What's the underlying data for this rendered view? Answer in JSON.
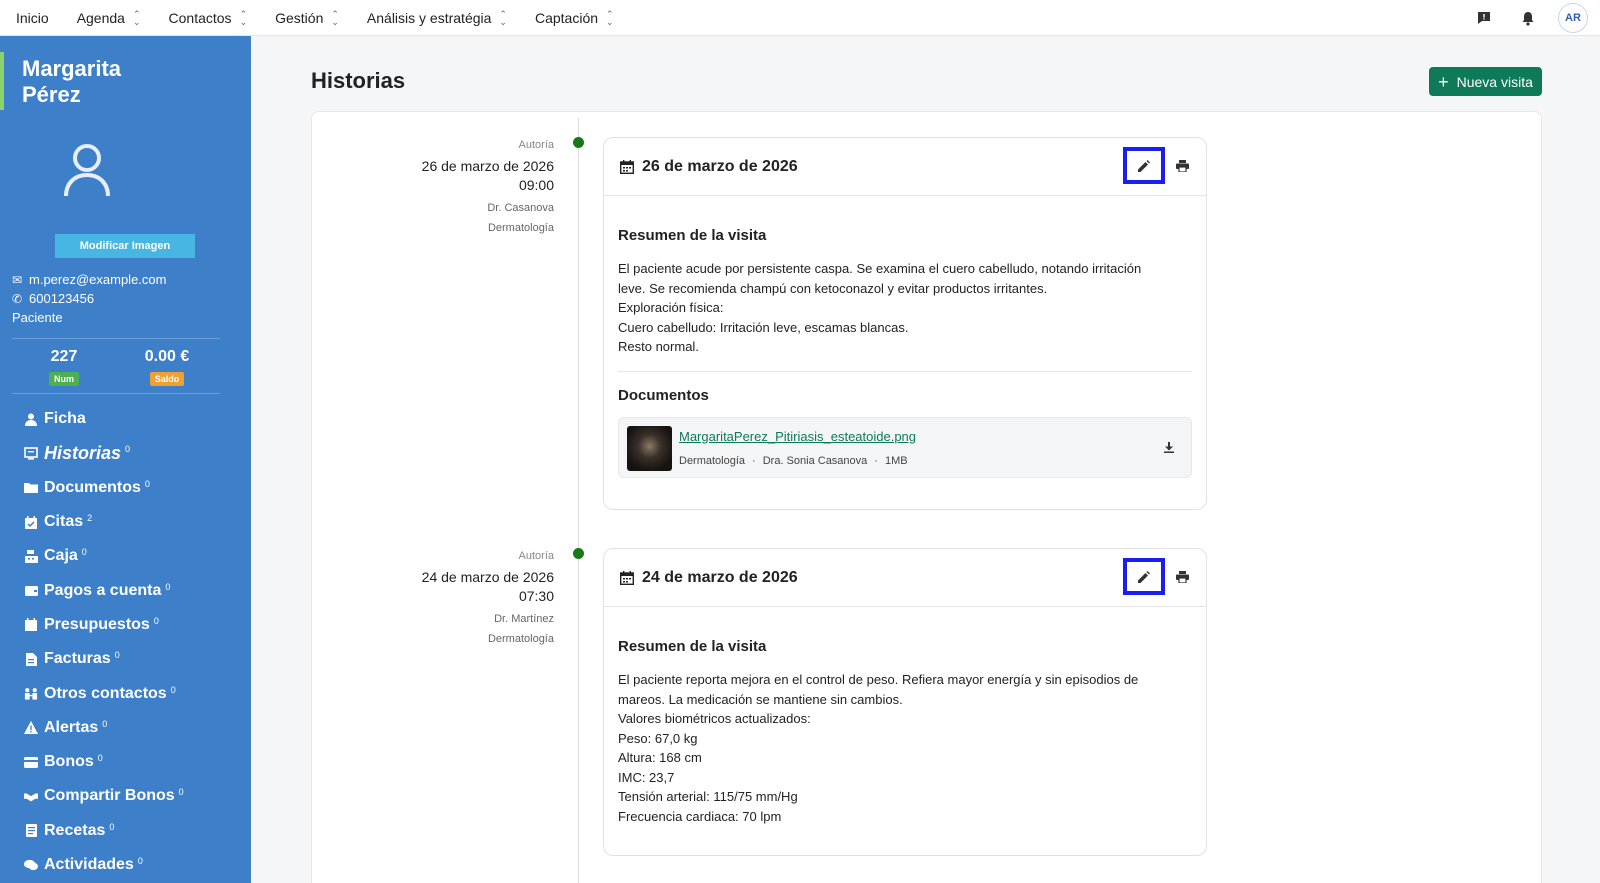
{
  "topnav": {
    "items": [
      "Inicio",
      "Agenda",
      "Contactos",
      "Gestión",
      "Análisis y estratégia",
      "Captación"
    ],
    "user_initials": "AR"
  },
  "sidebar": {
    "name_line1": "Margarita",
    "name_line2": "Pérez",
    "modify_image": "Modificar Imagen",
    "email": "m.perez@example.com",
    "phone": "600123456",
    "role": "Paciente",
    "stats": [
      {
        "value": "227",
        "tag": "Num",
        "color": "#4caf50"
      },
      {
        "value": "0.00 €",
        "tag": "Saldo",
        "color": "#f0a030"
      }
    ],
    "menu": [
      {
        "label": "Ficha",
        "count": "",
        "icon": "user-icon"
      },
      {
        "label": "Historias",
        "count": "0",
        "icon": "history-icon",
        "active": true
      },
      {
        "label": "Documentos",
        "count": "0",
        "icon": "folder-icon"
      },
      {
        "label": "Citas",
        "count": "2",
        "icon": "calendar-check-icon"
      },
      {
        "label": "Caja",
        "count": "0",
        "icon": "cash-register-icon"
      },
      {
        "label": "Pagos a cuenta",
        "count": "0",
        "icon": "wallet-icon"
      },
      {
        "label": "Presupuestos",
        "count": "0",
        "icon": "calendar-icon"
      },
      {
        "label": "Facturas",
        "count": "0",
        "icon": "invoice-icon"
      },
      {
        "label": "Otros contactos",
        "count": "0",
        "icon": "people-icon"
      },
      {
        "label": "Alertas",
        "count": "0",
        "icon": "alert-icon"
      },
      {
        "label": "Bonos",
        "count": "0",
        "icon": "card-icon"
      },
      {
        "label": "Compartir Bonos",
        "count": "0",
        "icon": "handshake-icon"
      },
      {
        "label": "Recetas",
        "count": "0",
        "icon": "prescription-icon"
      },
      {
        "label": "Actividades",
        "count": "0",
        "icon": "chat-icon"
      }
    ]
  },
  "main": {
    "title": "Historias",
    "new_visit": "Nueva visita"
  },
  "visits": [
    {
      "meta_label": "Autoría",
      "date": "26 de marzo de 2026",
      "time": "09:00",
      "doctor": "Dr. Casanova",
      "specialty": "Dermatología",
      "card_title": "26 de marzo de 2026",
      "summary_title": "Resumen de la visita",
      "summary": [
        "El paciente acude por persistente caspa. Se examina el cuero cabelludo, notando irritación",
        "leve. Se recomienda champú con ketoconazol y evitar productos irritantes.",
        "Exploración física:",
        "Cuero cabelludo: Irritación leve, escamas blancas.",
        "Resto normal."
      ],
      "documents_title": "Documentos",
      "document": {
        "name": "MargaritaPerez_Pitiriasis_esteatoide.png",
        "specialty": "Dermatología",
        "author": "Dra. Sonia Casanova",
        "size": "1MB"
      }
    },
    {
      "meta_label": "Autoría",
      "date": "24 de marzo de 2026",
      "time": "07:30",
      "doctor": "Dr. Martínez",
      "specialty": "Dermatología",
      "card_title": "24 de marzo de 2026",
      "summary_title": "Resumen de la visita",
      "summary": [
        "El paciente reporta mejora en el control de peso. Refiera mayor energía y sin episodios de",
        "mareos. La medicación se mantiene sin cambios.",
        "Valores biométricos actualizados:",
        "Peso: 67,0 kg",
        "Altura: 168 cm",
        "IMC: 23,7",
        "Tensión arterial: 115/75 mm/Hg",
        "Frecuencia cardiaca: 70 lpm"
      ]
    }
  ]
}
